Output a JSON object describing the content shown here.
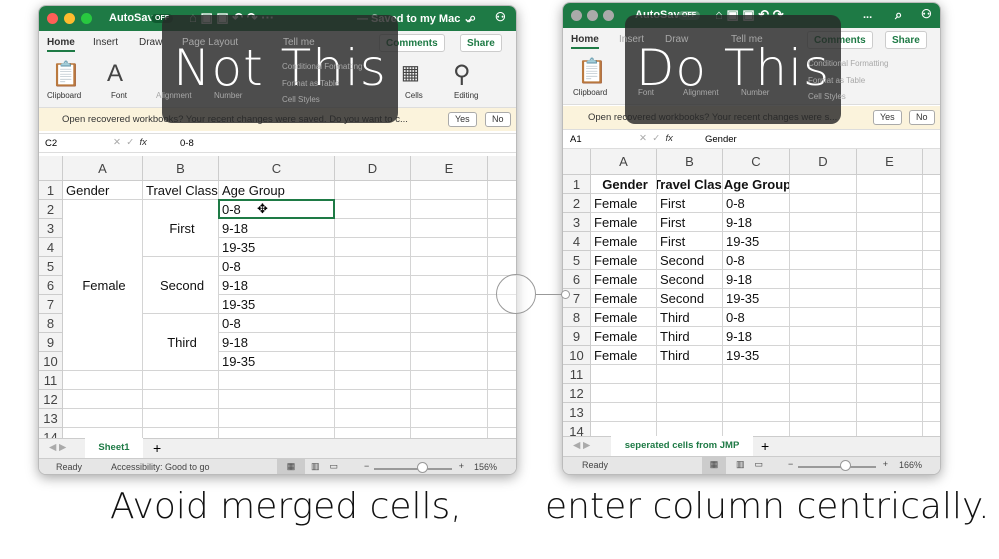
{
  "left": {
    "title": {
      "autosave": "AutoSave",
      "toggle": "OFF",
      "doc": "— Saved to my Mac ⌄"
    },
    "tabs": [
      "Home",
      "Insert",
      "Draw",
      "Page Layout",
      "Tell me"
    ],
    "comments": "Comments",
    "share": "Share",
    "ribbon": [
      "Clipboard",
      "Font",
      "Alignment",
      "Number",
      "Conditional Formatting",
      "Format as Table",
      "Cell Styles",
      "Cells",
      "Editing"
    ],
    "notice": "Open recovered workbooks?  Your recent changes were saved. Do you want to c...",
    "yes": "Yes",
    "no": "No",
    "namebox": "C2",
    "formula": "0-8",
    "columns": [
      "A",
      "B",
      "C",
      "D",
      "E"
    ],
    "rows": [
      "1",
      "2",
      "3",
      "4",
      "5",
      "6",
      "7",
      "8",
      "9",
      "10",
      "11",
      "12",
      "13",
      "14"
    ],
    "header": [
      "Gender",
      "Travel Class",
      "Age Group"
    ],
    "merged_gender": "Female",
    "merged_class": [
      "First",
      "Second",
      "Third"
    ],
    "age": [
      "0-8",
      "9-18",
      "19-35",
      "0-8",
      "9-18",
      "19-35",
      "0-8",
      "9-18",
      "19-35"
    ],
    "sheet": "Sheet1",
    "status": {
      "ready": "Ready",
      "access": "Accessibility: Good to go",
      "zoom": "156%",
      "zoom_fraction": 0.6
    },
    "overlay": "Not This",
    "caption": "Avoid merged cells,"
  },
  "right": {
    "title": {
      "autosave": "AutoSave",
      "toggle": "OFF",
      "doc": "..."
    },
    "tabs": [
      "Home",
      "Insert",
      "Draw",
      "Tell me"
    ],
    "comments": "Comments",
    "share": "Share",
    "ribbon": [
      "Clipboard",
      "Font",
      "Alignment",
      "Number",
      "Conditional Formatting",
      "Format as Table",
      "Cell Styles"
    ],
    "notice": "Open recovered workbooks?  Your recent changes were s...",
    "yes": "Yes",
    "no": "No",
    "namebox": "A1",
    "formula": "Gender",
    "columns": [
      "A",
      "B",
      "C",
      "D",
      "E"
    ],
    "rows": [
      "1",
      "2",
      "3",
      "4",
      "5",
      "6",
      "7",
      "8",
      "9",
      "10",
      "11",
      "12",
      "13",
      "14"
    ],
    "header": [
      "Gender",
      "Travel Class",
      "Age Group"
    ],
    "table": [
      [
        "Female",
        "First",
        "0-8"
      ],
      [
        "Female",
        "First",
        "9-18"
      ],
      [
        "Female",
        "First",
        "19-35"
      ],
      [
        "Female",
        "Second",
        "0-8"
      ],
      [
        "Female",
        "Second",
        "9-18"
      ],
      [
        "Female",
        "Second",
        "19-35"
      ],
      [
        "Female",
        "Third",
        "0-8"
      ],
      [
        "Female",
        "Third",
        "9-18"
      ],
      [
        "Female",
        "Third",
        "19-35"
      ]
    ],
    "sheet": "seperated cells from JMP",
    "status": {
      "ready": "Ready",
      "zoom": "166%",
      "zoom_fraction": 0.58
    },
    "overlay": "Do This",
    "caption": "enter column centrically."
  },
  "colors": {
    "excel_green": "#1e7a45",
    "notice": "#fbf3dc"
  }
}
